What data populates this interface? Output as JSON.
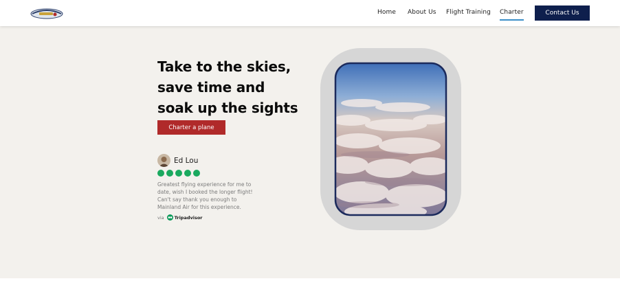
{
  "nav": {
    "items": [
      {
        "label": "Home"
      },
      {
        "label": "About Us"
      },
      {
        "label": "Flight Training"
      },
      {
        "label": "Charter",
        "active": true
      }
    ],
    "contact_label": "Contact Us"
  },
  "hero": {
    "title_lines": [
      "Take to the skies,",
      "save time and",
      "soak up the sights"
    ],
    "cta_label": "Charter a plane"
  },
  "review": {
    "name": "Ed Lou",
    "rating": 5,
    "quote_lines": [
      "Greatest flying experience for me to",
      "date, wish I booked the longer flight!",
      "Can't say thank you enough to",
      "Mainland Air for this experience."
    ],
    "via_label": "via",
    "source": "Tripadvisor"
  },
  "colors": {
    "brand_navy": "#0e1f4d",
    "cta_red": "#b02a2a",
    "rating_green": "#1aa95f",
    "active_underline": "#3b8fc7",
    "hero_bg": "#f3f1ed"
  },
  "icons": {
    "logo": "airline-logo",
    "avatar": "reviewer-avatar",
    "tripadvisor": "tripadvisor-owl-icon",
    "window_image": "clouds-through-airplane-window"
  }
}
